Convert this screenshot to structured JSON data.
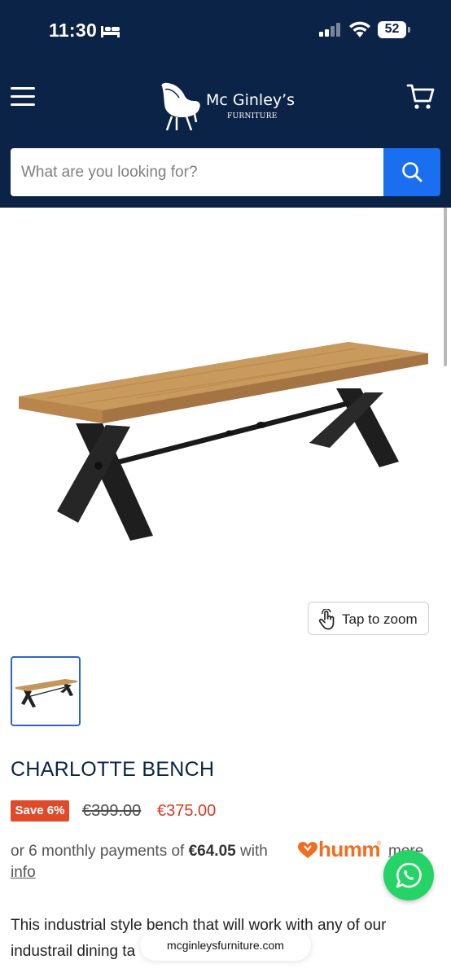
{
  "status_bar": {
    "time": "11:30",
    "battery": "52",
    "icons": [
      "bed-icon",
      "cellular-signal-icon",
      "wifi-icon",
      "battery-icon"
    ]
  },
  "header": {
    "background_color": "#0a2346",
    "logo_name": "Mc Ginley’s",
    "logo_sub": "FURNITURE",
    "icons": [
      "menu-icon",
      "chair-logo-icon",
      "cart-icon"
    ]
  },
  "search": {
    "placeholder": "What are you looking for?",
    "value": "",
    "button_color": "#1a6ff0",
    "icon": "search-icon"
  },
  "gallery": {
    "zoom_label": "Tap to zoom",
    "zoom_icon": "touch-hand-icon",
    "thumbnail_count": 1
  },
  "product": {
    "title": "CHARLOTTE BENCH",
    "save_badge": "Save 6%",
    "old_price": "€399.00",
    "new_price": "€375.00",
    "installments_prefix": "or 6 monthly payments of",
    "installment_amount": "€64.05",
    "installments_with": "with",
    "humm_logo": "humm",
    "humm_tm": "®",
    "more_text": "more",
    "info_link": "info",
    "description": "This industrial style bench that will work with any of our industrail dining ta"
  },
  "browser": {
    "url": "mcginleysfurniture.com"
  },
  "floating": {
    "whatsapp_icon": "whatsapp-icon",
    "whatsapp_color": "#25d366"
  },
  "colors": {
    "sale_badge": "#df4a2a",
    "sale_price": "#d73c22",
    "title": "#0a2346",
    "humm": "#f26d21"
  }
}
